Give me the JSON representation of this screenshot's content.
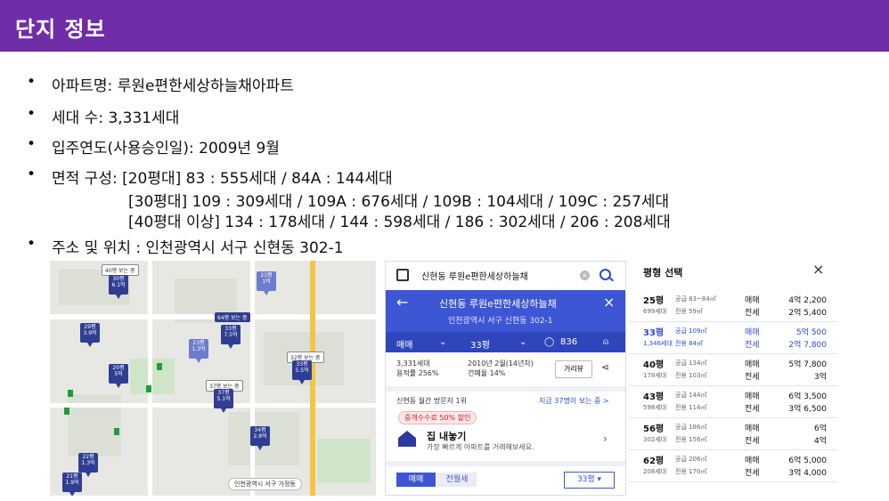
{
  "header": {
    "title": "단지 정보"
  },
  "bullets": {
    "marker": "•",
    "name": "아파트명: 루원e편한세상하늘채아파트",
    "households": "세대 수: 3,331세대",
    "year": "입주연도(사용승인일): 2009년 9월",
    "area_line1": "면적 구성: [20평대] 83 : 555세대 / 84A : 144세대",
    "area_line2": "[30평대] 109 : 309세대 / 109A : 676세대 / 109B : 104세대 / 109C : 257세대",
    "area_line3": "[40평대 이상] 134 : 178세대 / 144 : 598세대 / 186 : 302세대 / 206 : 208세대",
    "address": "주소  및 위치 : 인천광역시 서구 신현동 302-1"
  },
  "map": {
    "pins": [
      {
        "label": "30평\n6.1억"
      },
      {
        "label": "23평\n1억"
      },
      {
        "label": "29평\n3.9억"
      },
      {
        "label": "33평\n7.5억"
      },
      {
        "label": "23평\n1.3억"
      },
      {
        "label": "33평\n5.5억"
      },
      {
        "label": "20평\n5억"
      },
      {
        "label": "37평\n5.1억"
      },
      {
        "label": "34평\n2.8억"
      },
      {
        "label": "22평\n1.3억"
      },
      {
        "label": "21평\n1.9억"
      }
    ],
    "tags": [
      "40평 보는 중",
      "64평 보는 중",
      "32평 보는 중",
      "37평 보는 중"
    ],
    "bottom_label": "인천광역시 서구 가정동"
  },
  "phone": {
    "search_text": "신현동 루원e편한세상하늘채",
    "clear_icon": "×",
    "title": "신현동 루원e편한세상하늘채",
    "back": "←",
    "close": "×",
    "address": "인천광역시 서구 신현동 302-1",
    "deal_type": "매매",
    "size": "33평",
    "comment_count": "836",
    "stat1": "3,331세대",
    "stat2": "용적률 256%",
    "stat3": "2010년 2월(14년차)",
    "stat4": "건폐율 14%",
    "road_btn": "거리뷰",
    "visit_left": "신현동 월간 방문자 1위",
    "visit_right": "지금 37명이 보는 중 >",
    "promo": "중개수수료 50% 할인",
    "sell_title": "집 내놓기",
    "sell_sub": "가장 빠르게 아파트를 거래해보세요.",
    "tab_sale": "매매",
    "tab_rent": "전월세",
    "size_select": "33평 ▾"
  },
  "area_panel": {
    "title": "평형 선택",
    "rows": [
      {
        "py": "25평",
        "supply": "공급 83~84㎡",
        "hh": "699세대",
        "use": "전용 59㎡",
        "t1": "매매",
        "t2": "전세",
        "p1": "4억 2,200",
        "p2": "2억 5,400",
        "selected": false
      },
      {
        "py": "33평",
        "supply": "공급 109㎡",
        "hh": "1,346세대",
        "use": "전용 84㎡",
        "t1": "매매",
        "t2": "전세",
        "p1": "5억 500",
        "p2": "2억 7,800",
        "selected": true
      },
      {
        "py": "40평",
        "supply": "공급 134㎡",
        "hh": "178세대",
        "use": "전용 103㎡",
        "t1": "매매",
        "t2": "전세",
        "p1": "5억 7,800",
        "p2": "3억",
        "selected": false
      },
      {
        "py": "43평",
        "supply": "공급 144㎡",
        "hh": "598세대",
        "use": "전용 114㎡",
        "t1": "매매",
        "t2": "전세",
        "p1": "6억 3,500",
        "p2": "3억 6,500",
        "selected": false
      },
      {
        "py": "56평",
        "supply": "공급 186㎡",
        "hh": "302세대",
        "use": "전용 156㎡",
        "t1": "매매",
        "t2": "전세",
        "p1": "6억",
        "p2": "4억",
        "selected": false
      },
      {
        "py": "62평",
        "supply": "공급 206㎡",
        "hh": "208세대",
        "use": "전용 170㎡",
        "t1": "매매",
        "t2": "전세",
        "p1": "6억 5,000",
        "p2": "3억 4,000",
        "selected": false
      }
    ]
  }
}
